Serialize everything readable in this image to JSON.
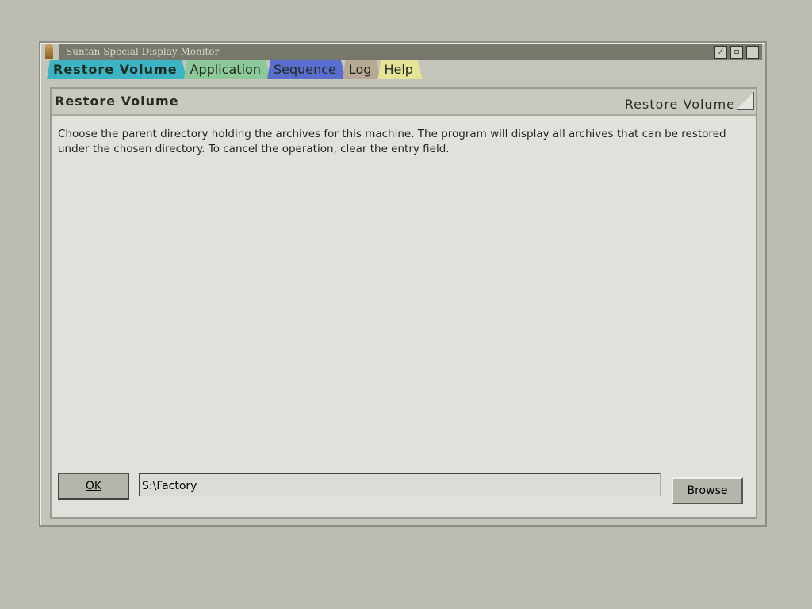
{
  "window": {
    "title": "Suntan Special Display Monitor"
  },
  "tabs": [
    {
      "label": "Restore Volume",
      "color": "#3cb4c4",
      "active": true
    },
    {
      "label": "Application",
      "color": "#8cc89a"
    },
    {
      "label": "Sequence",
      "color": "#5a6ed0"
    },
    {
      "label": "Log",
      "color": "#b8a896"
    },
    {
      "label": "Help",
      "color": "#e6e296"
    }
  ],
  "panel": {
    "title": "Restore Volume",
    "title_right": "Restore Volume",
    "description": "Choose the parent directory holding the archives for this machine. The program will display all archives that can be restored under the chosen directory. To cancel the operation, clear the entry field.",
    "ok_label": "OK",
    "path_value": "S:\\Factory",
    "browse_label": "Browse"
  }
}
